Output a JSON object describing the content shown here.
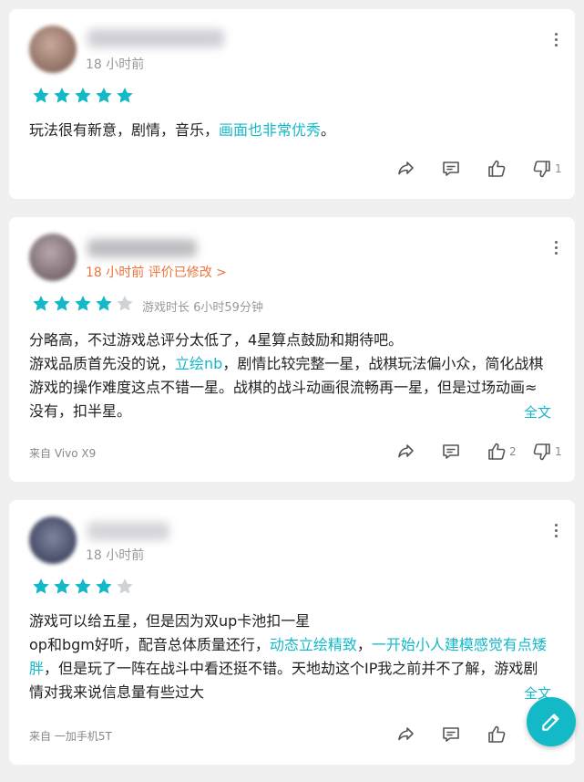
{
  "colors": {
    "accent": "#14b9c8",
    "modified": "#f0733c",
    "star_empty": "#cfd3d6"
  },
  "reviews": [
    {
      "time": "18 小时前",
      "stars": 5,
      "text_segments": [
        {
          "text": "玩法很有新意，剧情，音乐，",
          "highlight": false
        },
        {
          "text": "画面也非常优秀",
          "highlight": true
        },
        {
          "text": "。",
          "highlight": false
        }
      ],
      "actions": {
        "share": "share-icon",
        "comment": "comment-icon",
        "like_count": "",
        "dislike_count": "1"
      }
    },
    {
      "time": "18 小时前 评价已修改 >",
      "stars": 4,
      "playtime": "游戏时长 6小时59分钟",
      "text_segments": [
        {
          "text": "分略高，不过游戏总评分太低了，4星算点鼓励和期待吧。\n游戏品质首先没的说，",
          "highlight": false
        },
        {
          "text": "立绘nb",
          "highlight": true
        },
        {
          "text": "，剧情比较完整一星，战棋玩法偏小众，简化战棋游戏的操作难度这点不错一星。战棋的战斗动画很流畅再一星，但是过场动画≈没有，扣半星。",
          "highlight": false
        }
      ],
      "fulltext": "全文",
      "device": "来自 Vivo X9",
      "actions": {
        "like_count": "2",
        "dislike_count": "1"
      }
    },
    {
      "time": "18 小时前",
      "stars": 4,
      "text_segments": [
        {
          "text": "游戏可以给五星，但是因为双up卡池扣一星\nop和bgm好听，配音总体质量还行，",
          "highlight": false
        },
        {
          "text": "动态立绘精致",
          "highlight": true
        },
        {
          "text": "，",
          "highlight": false
        },
        {
          "text": "一开始小人建模感觉有点矮胖",
          "highlight": true
        },
        {
          "text": "，但是玩了一阵在战斗中看还挺不错。天地劫这个IP我之前并不了解，游戏剧情对我来说信息量有些过大",
          "highlight": false
        }
      ],
      "fulltext": "全文",
      "device": "来自 一加手机5T",
      "actions": {
        "like_count": "",
        "dislike_count": ""
      }
    }
  ],
  "fab_icon": "edit-icon"
}
